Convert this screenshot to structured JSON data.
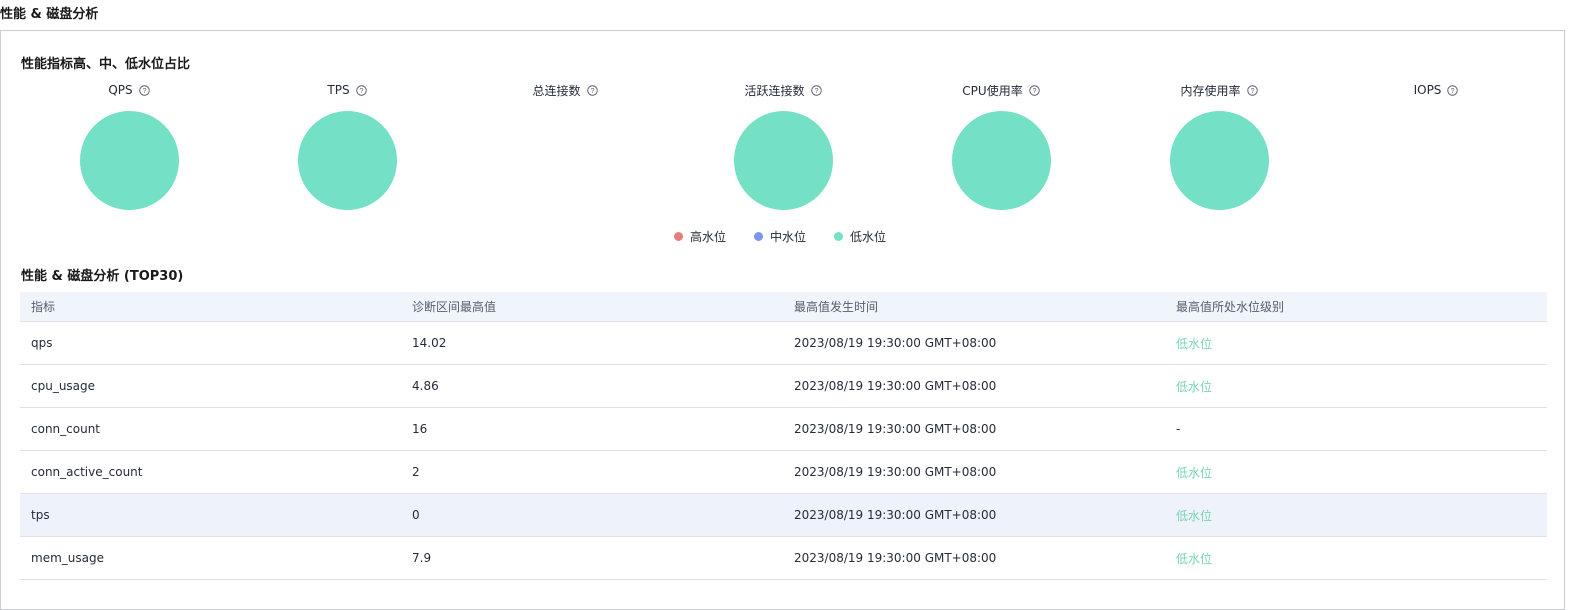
{
  "page_title": "性能 & 磁盘分析",
  "ratio_section": {
    "title": "性能指标高、中、低水位占比",
    "metrics": [
      {
        "label": "QPS",
        "has_chart": true
      },
      {
        "label": "TPS",
        "has_chart": true
      },
      {
        "label": "总连接数",
        "has_chart": false
      },
      {
        "label": "活跃连接数",
        "has_chart": true
      },
      {
        "label": "CPU使用率",
        "has_chart": true
      },
      {
        "label": "内存使用率",
        "has_chart": true
      },
      {
        "label": "IOPS",
        "has_chart": false
      }
    ],
    "pie_share": {
      "high": 0,
      "medium": 0,
      "low": 1.0
    },
    "legend": [
      {
        "label": "高水位",
        "color": "#e87b7b"
      },
      {
        "label": "中水位",
        "color": "#7b94ec"
      },
      {
        "label": "低水位",
        "color": "#74e0c5"
      }
    ],
    "pie_color": "#74e0c5"
  },
  "table_section": {
    "title": "性能 & 磁盘分析 (TOP30)",
    "columns": [
      "指标",
      "诊断区间最高值",
      "最高值发生时间",
      "最高值所处水位级别"
    ],
    "rows": [
      {
        "metric": "qps",
        "max": "14.02",
        "time": "2023/08/19 19:30:00 GMT+08:00",
        "level": "低水位"
      },
      {
        "metric": "cpu_usage",
        "max": "4.86",
        "time": "2023/08/19 19:30:00 GMT+08:00",
        "level": "低水位"
      },
      {
        "metric": "conn_count",
        "max": "16",
        "time": "2023/08/19 19:30:00 GMT+08:00",
        "level": "-"
      },
      {
        "metric": "conn_active_count",
        "max": "2",
        "time": "2023/08/19 19:30:00 GMT+08:00",
        "level": "低水位"
      },
      {
        "metric": "tps",
        "max": "0",
        "time": "2023/08/19 19:30:00 GMT+08:00",
        "level": "低水位"
      },
      {
        "metric": "mem_usage",
        "max": "7.9",
        "time": "2023/08/19 19:30:00 GMT+08:00",
        "level": "低水位"
      }
    ],
    "highlighted_row": 4,
    "low_level_color": "#7ad5b0"
  }
}
